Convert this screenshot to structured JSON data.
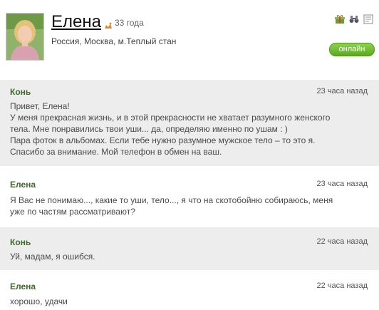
{
  "profile": {
    "name": "Елена",
    "age": "33 года",
    "location": "Россия, Москва, м.Теплый стан",
    "status_button": "онлайн"
  },
  "messages": [
    {
      "author": "Конь",
      "time": "23 часа назад",
      "lines": [
        "Привет, Елена!",
        "У меня прекрасная жизнь, и в этой прекрасности не хватает разумного женского",
        "тела. Мне понравились твои уши... да, определяю именно по ушам : )",
        "Пара фоток в альбомах. Если тебе нужно разумное мужское тело – то это я.",
        "Спасибо за внимание. Мой телефон в обмен на ваш."
      ]
    },
    {
      "author": "Елена",
      "time": "23 часа назад",
      "lines": [
        "Я Вас не понимаю..., какие то уши, тело..., я что на скотобойню собираюсь, меня",
        "уже по частям рассматривают?"
      ]
    },
    {
      "author": "Конь",
      "time": "22 часа назад",
      "lines": [
        "Уй, мадам, я ошибся."
      ]
    },
    {
      "author": "Елена",
      "time": "22 часа назад",
      "lines": [
        "хорошо, удачи"
      ]
    }
  ],
  "icons": {
    "age": "zodiac-icon",
    "tools": [
      "gift-icon",
      "binoculars-icon",
      "report-icon"
    ]
  },
  "colors": {
    "author": "#3d6a2a",
    "online": "#66b22a",
    "grey_row": "#ecedec"
  }
}
